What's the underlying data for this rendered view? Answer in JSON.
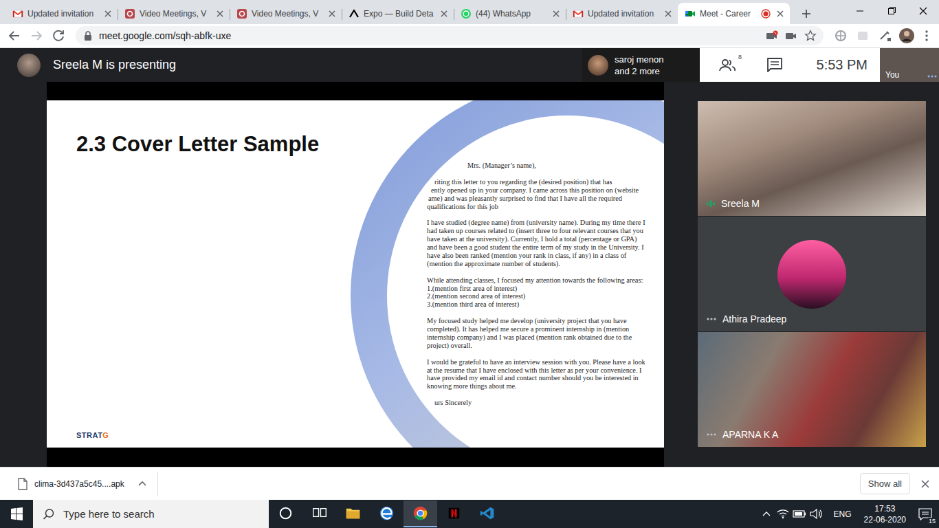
{
  "browser": {
    "tabs": [
      {
        "title": "Updated invitation",
        "kind": "gmail",
        "selected": false,
        "recording": false
      },
      {
        "title": "Video Meetings, V",
        "kind": "whereby",
        "selected": false,
        "recording": false
      },
      {
        "title": "Video Meetings, V",
        "kind": "whereby",
        "selected": false,
        "recording": false
      },
      {
        "title": "Expo — Build Deta",
        "kind": "expo",
        "selected": false,
        "recording": false
      },
      {
        "title": "(44) WhatsApp",
        "kind": "whatsapp",
        "selected": false,
        "recording": false
      },
      {
        "title": "Updated invitation",
        "kind": "gmail",
        "selected": false,
        "recording": false
      },
      {
        "title": "Meet - Career",
        "kind": "meet",
        "selected": true,
        "recording": true
      }
    ],
    "url": "meet.google.com/sqh-abfk-uxe"
  },
  "meet": {
    "presenting": "Sreela M is presenting",
    "others": {
      "name": "saroj menon",
      "more": "and 2 more"
    },
    "participants": "8",
    "time": "5:53 PM",
    "self": "You",
    "slide": {
      "title": "2.3 Cover Letter Sample",
      "logo": {
        "main": "STRAT",
        "accent": "G"
      },
      "letter": {
        "salutation": "Mrs. (Manager’s name),",
        "paragraphs": [
          [
            "riting this letter to you regarding the (desired position) that has",
            "ently opened up in your company. I came across this position on (website",
            "ame) and was pleasantly surprised to find that I have all the required",
            "qualifications for this job"
          ],
          [
            "I have studied (degree name) from (university name). During my time there I",
            "had taken up courses related to (insert three to four relevant courses that you",
            "have taken at the university). Currently, I hold a total (percentage or GPA)",
            "and have been a good student the entire term of my study in the University. I",
            "have also been ranked (mention your rank in class, if any) in a class of",
            "(mention the approximate number of students)."
          ],
          [
            "While attending classes, I focused my attention towards the following areas:",
            "1.(mention first area of interest)",
            "2.(mention second area of interest)",
            "3.(mention third area of interest)"
          ],
          [
            "My focused study helped me develop (university project that you have",
            "completed). It has helped me secure a prominent internship in (mention",
            "internship company) and I was placed (mention rank obtained due to the",
            "project) overall."
          ],
          [
            "I would be grateful to have an interview session with you. Please have a look",
            "at the resume that I have enclosed with this letter as per your convenience. I",
            "have provided my email id and contact number should you be interested in",
            "knowing more things about me."
          ]
        ],
        "closing": "urs Sincerely"
      }
    },
    "tiles": [
      {
        "name": "Sreela M",
        "kind": "video",
        "speaking": true
      },
      {
        "name": "Athira Pradeep",
        "kind": "avatar",
        "speaking": false
      },
      {
        "name": "APARNA K A",
        "kind": "video",
        "speaking": false
      }
    ]
  },
  "downloads": {
    "file": "clima-3d437a5c45....apk",
    "show_all": "Show all"
  },
  "taskbar": {
    "search_placeholder": "Type here to search",
    "apps": [
      {
        "kind": "cortana",
        "selected": false
      },
      {
        "kind": "taskview",
        "selected": false
      },
      {
        "kind": "explorer",
        "selected": false
      },
      {
        "kind": "edge",
        "selected": false
      },
      {
        "kind": "chrome",
        "selected": true
      },
      {
        "kind": "netflix",
        "selected": false
      },
      {
        "kind": "vscode",
        "selected": false
      }
    ],
    "language": "ENG",
    "time": "17:53",
    "date": "22-06-2020",
    "notifications": "15"
  }
}
